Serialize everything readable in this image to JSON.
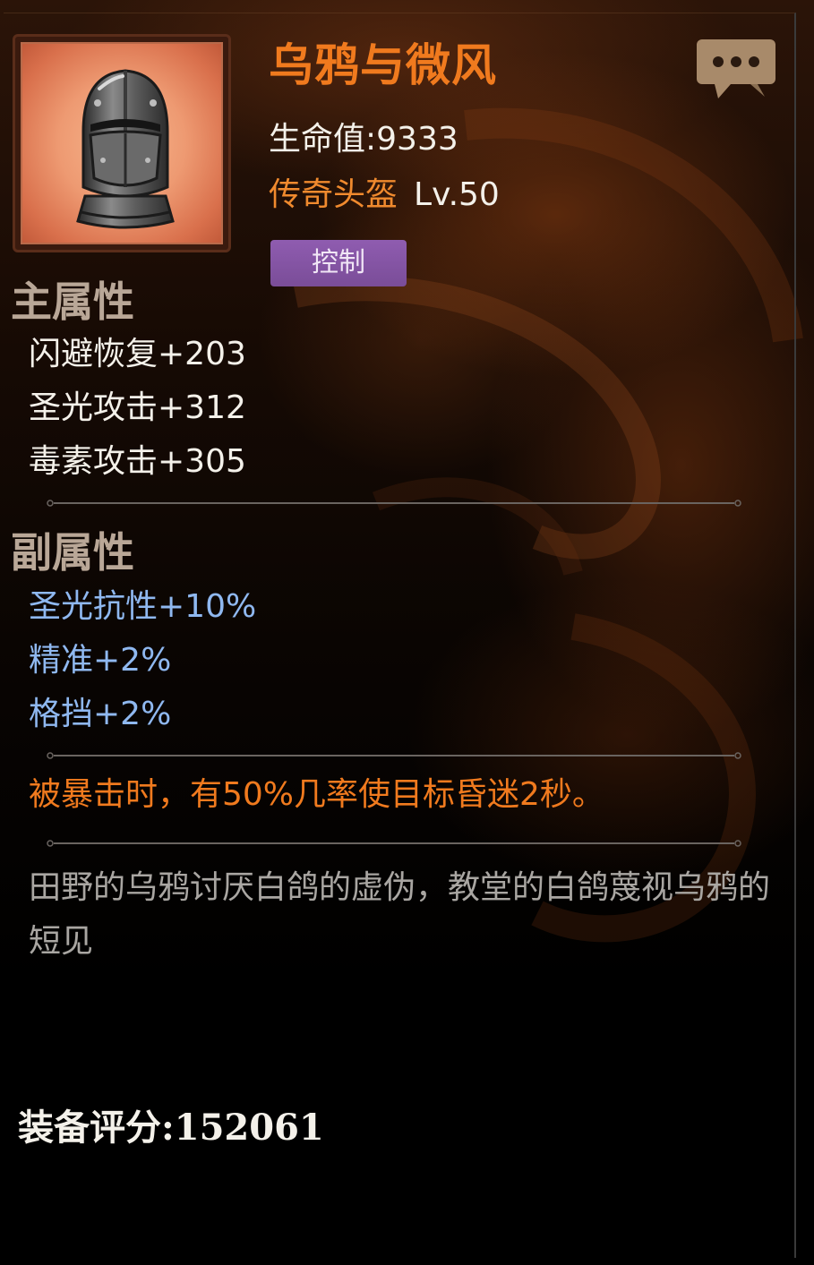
{
  "item": {
    "name": "乌鸦与微风",
    "hp_label": "生命值:",
    "hp_value": "9333",
    "type": "传奇头盔",
    "level": "Lv.50",
    "tag": "控制"
  },
  "main_attributes": {
    "title": "主属性",
    "items": [
      "闪避恢复+203",
      "圣光攻击+312",
      "毒素攻击+305"
    ]
  },
  "sub_attributes": {
    "title": "副属性",
    "items": [
      "圣光抗性+10%",
      "精准+2%",
      "格挡+2%"
    ]
  },
  "effect": "被暴击时，有50%几率使目标昏迷2秒。",
  "flavor_text": "田野的乌鸦讨厌白鸽的虚伪，教堂的白鸽蔑视乌鸦的短见",
  "score": {
    "label": "装备评分:",
    "value": "152061"
  },
  "colors": {
    "title": "#f07a1e",
    "type": "#f08a2e",
    "sub_stat": "#8fb8f0",
    "tag_bg": "#8a58a8",
    "flavor": "#a9a6a2"
  },
  "icons": {
    "item": "knight-helmet-icon",
    "chat": "chat-bubble-icon"
  }
}
